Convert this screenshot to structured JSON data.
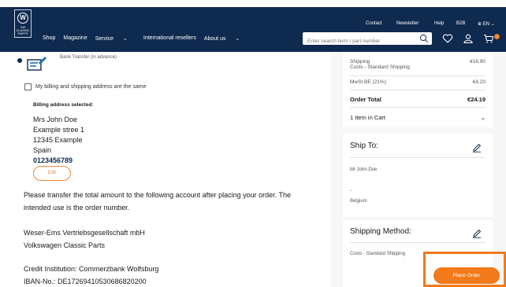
{
  "header": {
    "logo_text": "VW CLASSIC PARTS",
    "top_links": [
      "Contact",
      "Newsletter",
      "Help",
      "B2B",
      "EN"
    ],
    "nav": [
      "Shop",
      "Magazine",
      "Service",
      "International resellers",
      "About us"
    ],
    "search_placeholder": "Enter search term / part number",
    "cart_count": "0"
  },
  "payment": {
    "bank_label": "Bank Transfer (in advance)"
  },
  "billing": {
    "same_address_label": "My billing and shipping address are the same",
    "selected_title": "Billing address selected:",
    "lines": [
      "Mrs John Doe",
      "Example stree 1",
      "12345 Example",
      "Spain"
    ],
    "phone": "0123456789",
    "edit_label": "Edit"
  },
  "instructions": {
    "line1": "Please transfer the total amount to the following account after placing your order. The",
    "line2": "intended use is the order number.",
    "company1": "Weser-Ems Vertriebsgesellschaft mbH",
    "company2": "Volkswagen Classic Parts",
    "bank": "Credit Institution: Commerzbank Wolfsburg",
    "iban": "IBAN-No.: DE17269410530686820200"
  },
  "summary": {
    "shipping_label": "Shipping",
    "shipping_sub": "Costs - Standard Shipping",
    "shipping_value": "€16.90",
    "vat_label": "MwSt BE (21%)",
    "vat_value": "€4.20",
    "total_label": "Order Total",
    "total_value": "€24.19",
    "items_label": "1 Item in Cart"
  },
  "ship_to": {
    "title": "Ship To:",
    "name": "Mr John Doe",
    "dash": "-",
    "country": "Belgium"
  },
  "shipping_method": {
    "title": "Shipping Method:",
    "value": "Costs - Standard Shipping"
  },
  "actions": {
    "place_order": "Place Order"
  },
  "colors": {
    "header_bg": "#0f2a4f",
    "accent": "#f27a1a"
  }
}
